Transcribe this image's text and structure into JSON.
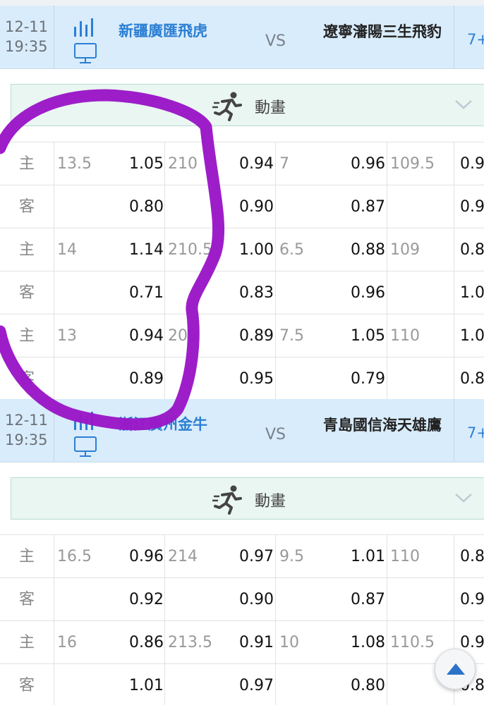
{
  "matches": [
    {
      "time": "12-11\n19:35",
      "home": "新疆廣匯飛虎",
      "vs": "VS",
      "away": "遼寧瀋陽三生飛豹",
      "more": "7+",
      "animation_label": "動畫",
      "rows": [
        [
          "主",
          "13.5",
          "1.05",
          "210",
          "0.94",
          "7",
          "0.96",
          "109.5",
          "0.9"
        ],
        [
          "客",
          "",
          "0.80",
          "",
          "0.90",
          "",
          "0.87",
          "",
          "0.9"
        ],
        [
          "主",
          "14",
          "1.14",
          "210.5",
          "1.00",
          "6.5",
          "0.88",
          "109",
          "0.8"
        ],
        [
          "客",
          "",
          "0.71",
          "",
          "0.83",
          "",
          "0.96",
          "",
          "1.0"
        ],
        [
          "主",
          "13",
          "0.94",
          "209",
          "0.89",
          "7.5",
          "1.05",
          "110",
          "1.0"
        ],
        [
          "客",
          "",
          "0.89",
          "",
          "0.95",
          "",
          "0.79",
          "",
          "0.8"
        ]
      ]
    },
    {
      "time": "12-11\n19:35",
      "home": "浙江廣州金牛",
      "vs": "VS",
      "away": "青島國信海天雄鷹",
      "more": "7+",
      "animation_label": "動畫",
      "rows": [
        [
          "主",
          "16.5",
          "0.96",
          "214",
          "0.97",
          "9.5",
          "1.01",
          "110",
          "0.8"
        ],
        [
          "客",
          "",
          "0.92",
          "",
          "0.90",
          "",
          "0.87",
          "",
          "0.9"
        ],
        [
          "主",
          "16",
          "0.86",
          "213.5",
          "0.91",
          "10",
          "1.08",
          "110.5",
          "0.9"
        ],
        [
          "客",
          "",
          "1.01",
          "",
          "0.97",
          "",
          "0.80",
          "",
          "0.8"
        ]
      ]
    }
  ],
  "colors": {
    "header_bg": "#d9ecfb",
    "link_blue": "#2b7fd4",
    "animation_bar_bg": "#eaf6f1",
    "scribble": "#9a17c7"
  }
}
